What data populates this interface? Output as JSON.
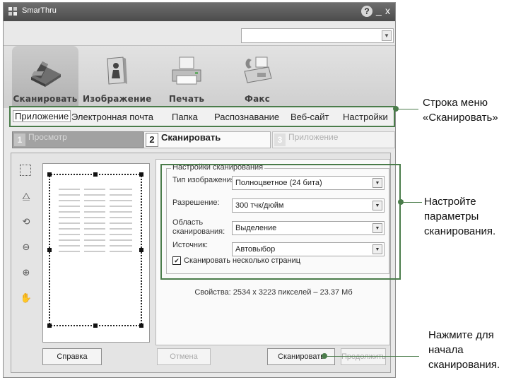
{
  "window": {
    "title": "SmarThru",
    "help_glyph": "?",
    "minimize_glyph": "_",
    "close_glyph": "x"
  },
  "toolbar": {
    "buttons": [
      {
        "label": "Сканировать",
        "icon": "scanner-icon",
        "active": true
      },
      {
        "label": "Изображение",
        "icon": "image-icon",
        "active": false
      },
      {
        "label": "Печать",
        "icon": "printer-icon",
        "active": false
      },
      {
        "label": "Факс",
        "icon": "fax-icon",
        "active": false
      }
    ]
  },
  "menu": {
    "items": [
      "Приложение",
      "Электронная почта",
      "Папка",
      "Распознавание",
      "Веб-сайт",
      "Настройки"
    ],
    "active_index": 0
  },
  "steps": [
    {
      "num": "1",
      "label": "Просмотр"
    },
    {
      "num": "2",
      "label": "Сканировать"
    },
    {
      "num": "3",
      "label": "Приложение"
    }
  ],
  "settings": {
    "group_label": "Настройки сканирования",
    "image_type_label": "Тип изображения:",
    "image_type_value": "Полноцветное (24 бита)",
    "resolution_label": "Разрешение:",
    "resolution_value": "300 тчк/дюйм",
    "area_label_1": "Область",
    "area_label_2": "сканирования:",
    "area_value": "Выделение",
    "source_label": "Источник:",
    "source_value": "Автовыбор",
    "multipage_label": "Сканировать несколько страниц",
    "multipage_checked": true,
    "properties": "Свойства: 2534 x 3223 пикселей – 23.37 Мб"
  },
  "buttons": {
    "help": "Справка",
    "cancel": "Отмена",
    "scan": "Сканировать",
    "next": "Продолжить"
  },
  "annotations": {
    "menu_line1": "Строка меню",
    "menu_line2": "«Сканировать»",
    "settings_line1": "Настройте",
    "settings_line2": "параметры",
    "settings_line3": "сканирования.",
    "scan_line1": "Нажмите для",
    "scan_line2": "начала",
    "scan_line3": "сканирования."
  },
  "colors": {
    "callout": "#4a7c4a",
    "title_bar": "#4b4b4b"
  }
}
